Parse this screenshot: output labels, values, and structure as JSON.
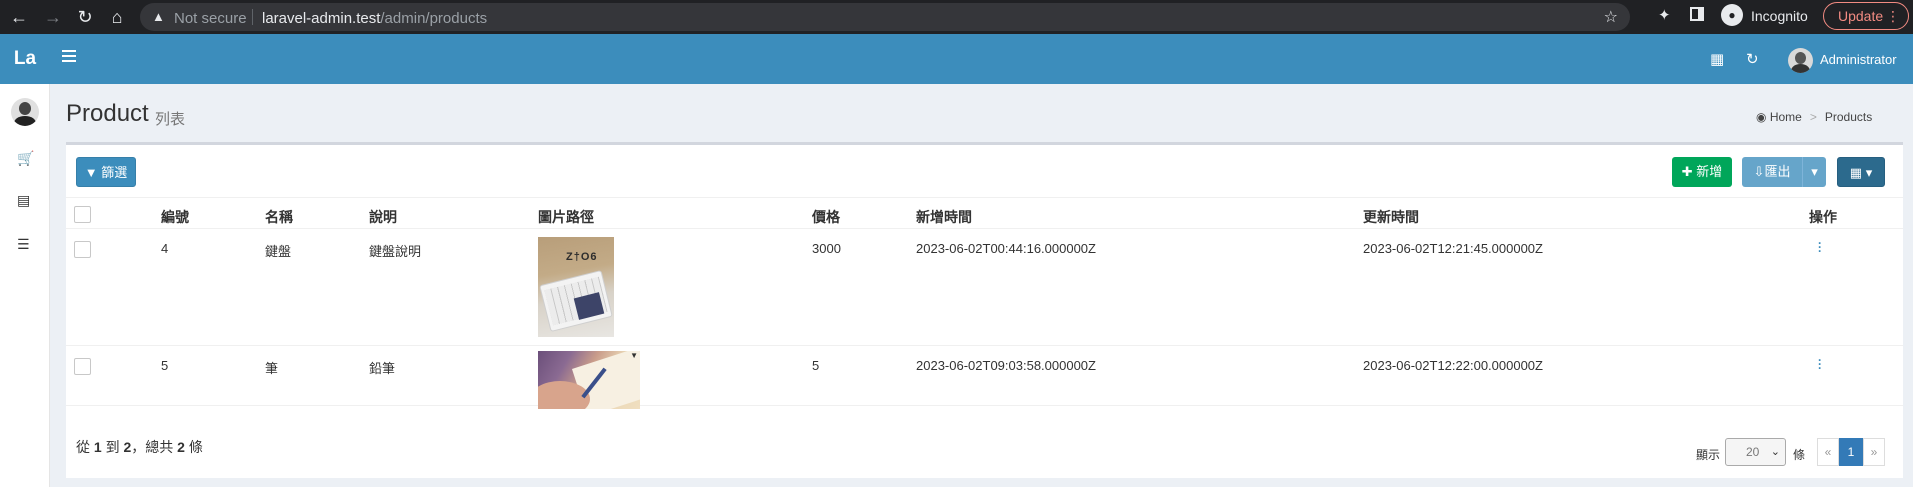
{
  "browser": {
    "security": "Not secure",
    "url_host": "laravel-admin.test",
    "url_path": "/admin/products",
    "profile": "Incognito",
    "update_label": "Update"
  },
  "header": {
    "logo": "La",
    "user_name": "Administrator"
  },
  "page": {
    "title": "Product",
    "subtitle": "列表",
    "breadcrumb": [
      "Home",
      "Products"
    ]
  },
  "toolbar": {
    "filter_label": "篩選",
    "new_label": "新增",
    "export_label": "匯出"
  },
  "table": {
    "columns": [
      "編號",
      "名稱",
      "說明",
      "圖片路徑",
      "價格",
      "新增時間",
      "更新時間",
      "操作"
    ],
    "rows": [
      {
        "id": "4",
        "name": "鍵盤",
        "desc": "鍵盤說明",
        "image": "keyboard",
        "price": "3000",
        "created": "2023-06-02T00:44:16.000000Z",
        "updated": "2023-06-02T12:21:45.000000Z"
      },
      {
        "id": "5",
        "name": "筆",
        "desc": "鉛筆",
        "image": "pencil",
        "price": "5",
        "created": "2023-06-02T09:03:58.000000Z",
        "updated": "2023-06-02T12:22:00.000000Z"
      }
    ]
  },
  "footer": {
    "summary_from": "從",
    "summary_start": "1",
    "summary_to": "到",
    "summary_end": "2",
    "summary_total_pre": "，總共",
    "summary_total": "2",
    "summary_unit": "條",
    "per_page_label": "顯示",
    "per_page_value": "20",
    "per_page_unit": "條",
    "prev": "«",
    "current_page": "1",
    "next": "»"
  },
  "icons": {
    "back": "arrow-left-icon",
    "forward": "arrow-right-icon",
    "reload": "reload-icon",
    "home": "home-icon",
    "bookmark": "star-icon",
    "extensions": "puzzle-icon",
    "language": "language-icon",
    "refresh": "refresh-icon",
    "sidebar": [
      "cart-icon",
      "bar-chart-icon",
      "list-icon"
    ]
  },
  "colors": {
    "header": "#3c8dbc",
    "new_button": "#00a65a",
    "active_page": "#337ab7"
  }
}
